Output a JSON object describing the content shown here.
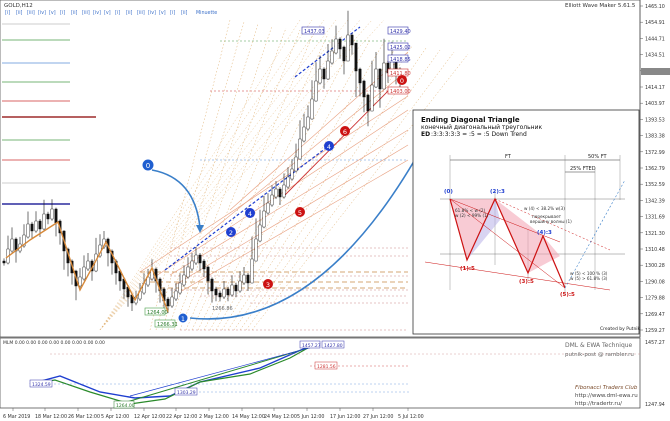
{
  "symbol": "GOLD,H12",
  "indicator_title": "Elliott Wave Maker 5.61.5",
  "timeframes": [
    "[i]",
    "[ii]",
    "[iii]",
    "[iv]",
    "[v]",
    "[i]",
    "[ii]",
    "[iii]",
    "[iv]",
    "[v]",
    "[i]",
    "[ii]",
    "[iii]",
    "[iv]",
    "[v]",
    "[i]",
    "[ii]",
    "Minuette"
  ],
  "wave_labels": {
    "main_0": "0",
    "main_1": "1",
    "main_2": "2",
    "main_3": "3",
    "main_4": "4",
    "main_5": "5",
    "main_6": "6",
    "blue_1": "1",
    "blue_2": "2",
    "blue_3": "3",
    "blue_4": "4",
    "red_0": "0"
  },
  "price_tags": {
    "top_high": "1437.03",
    "tag_1429": "1429.40",
    "tag_1425": "1425.02",
    "tag_1419": "1418.85",
    "tag_1411": "1411.80",
    "tag_1403": "1403.00",
    "low_a": "1264.00",
    "low_b": "1266.31",
    "low_c": "1266.86"
  },
  "price_axis": {
    "ticks": [
      "1465.10",
      "1454.91",
      "1444.71",
      "1434.51",
      "1424.31",
      "1414.17",
      "1403.97",
      "1393.53",
      "1383.38",
      "1372.99",
      "1362.79",
      "1352.59",
      "1342.39",
      "1331.69",
      "1321.30",
      "1310.48",
      "1300.28",
      "1290.08",
      "1279.88",
      "1269.47",
      "1259.27"
    ]
  },
  "sub_axis": {
    "ticks": [
      "1457.27",
      "1247.94"
    ]
  },
  "mini_panel_header": "MLM 0.00 0.00 0.00 0.00 0.00 0.00 0.00 0.00",
  "mini_tags": [
    "1324.59",
    "1303.29",
    "1281.56",
    "1457.27",
    "1264.00",
    "1427.80",
    "1281.00"
  ],
  "watermarks": {
    "line1": "DML & EWA Technique",
    "line2": "putnik-post @ rambler.ru",
    "line3": "Fibonacci Traders Club",
    "line4": "http://www.dml-ewa.ru",
    "line5": "http://tradertr.ru/"
  },
  "time_axis": [
    "6 Mar 2019",
    "18 Mar 12:00",
    "26 Mar 12:00",
    "5 Apr 12:00",
    "12 Apr 12:00",
    "22 Apr 12:00",
    "2 May 12:00",
    "14 May 12:00",
    "24 May 12:00",
    "5 Jun 12:00",
    "17 Jun 12:00",
    "27 Jun 12:00",
    "5 Jul 12:00"
  ],
  "diagram": {
    "title": "Ending Diagonal Triangle",
    "subtitle": "конечный диагональный треугольник",
    "formula_bold": "ED",
    "formula": ":3:3:3:3:3 = :5 = :5 Down Trend",
    "ft_label": "FT",
    "ft50_label": "50% FT",
    "ft25_label": "25% FTED",
    "points": {
      "p0": "(0)",
      "p1": "(1):5",
      "p2": "(2):3",
      "p3": "(3):5",
      "p4": "(4):3",
      "p5": "(5):5"
    },
    "note_left": [
      "61.8% < w (2)",
      "w (2) < 99% (1)"
    ],
    "note_mid": [
      "w (4) < 38.2% w(3)",
      "перекрывает",
      "вершину волны (1)"
    ],
    "note_right": [
      "w (5) < 100 % (3)",
      "w (5) > 61.8% (3)"
    ],
    "credit": "Created by Putnik"
  }
}
